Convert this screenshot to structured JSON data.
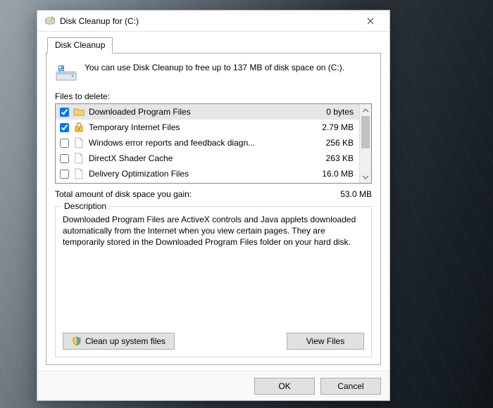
{
  "window": {
    "title": "Disk Cleanup for  (C:)"
  },
  "tab": {
    "label": "Disk Cleanup"
  },
  "info": {
    "text": "You can use Disk Cleanup to free up to 137 MB of disk space on (C:)."
  },
  "files": {
    "label": "Files to delete:",
    "items": [
      {
        "checked": true,
        "icon": "folder",
        "name": "Downloaded Program Files",
        "size": "0 bytes",
        "selected": true
      },
      {
        "checked": true,
        "icon": "lock",
        "name": "Temporary Internet Files",
        "size": "2.79 MB",
        "selected": false
      },
      {
        "checked": false,
        "icon": "file",
        "name": "Windows error reports and feedback diagn...",
        "size": "256 KB",
        "selected": false
      },
      {
        "checked": false,
        "icon": "file",
        "name": "DirectX Shader Cache",
        "size": "263 KB",
        "selected": false
      },
      {
        "checked": false,
        "icon": "file",
        "name": "Delivery Optimization Files",
        "size": "16.0 MB",
        "selected": false
      }
    ]
  },
  "total": {
    "label": "Total amount of disk space you gain:",
    "value": "53.0 MB"
  },
  "description": {
    "title": "Description",
    "text": "Downloaded Program Files are ActiveX controls and Java applets downloaded automatically from the Internet when you view certain pages. They are temporarily stored in the Downloaded Program Files folder on your hard disk."
  },
  "buttons": {
    "cleanup": "Clean up system files",
    "view": "View Files",
    "ok": "OK",
    "cancel": "Cancel"
  }
}
